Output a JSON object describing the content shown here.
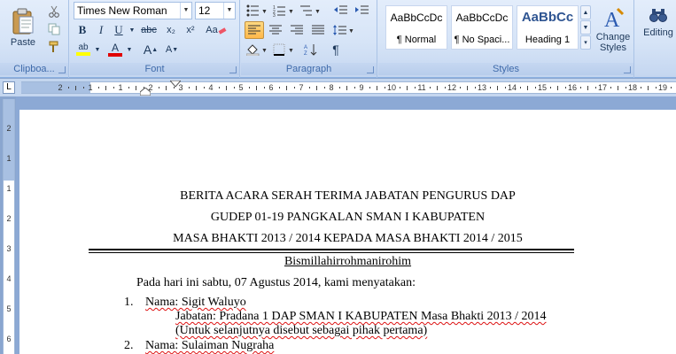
{
  "ribbon": {
    "clipboard": {
      "paste_label": "Paste",
      "group_label": "Clipboa..."
    },
    "font": {
      "font_name": "Times New Roman",
      "font_size": "12",
      "bold": "B",
      "italic": "I",
      "underline": "U",
      "strikethrough": "abc",
      "subscript": "x₂",
      "superscript": "x²",
      "clear_format": "Aa",
      "highlight_label": "ab",
      "font_color_label": "A",
      "grow_font": "A",
      "shrink_font": "A",
      "group_label": "Font"
    },
    "paragraph": {
      "show_marks": "¶",
      "group_label": "Paragraph"
    },
    "styles": {
      "tiles": [
        {
          "sample": "AaBbCcDc",
          "name": "¶ Normal"
        },
        {
          "sample": "AaBbCcDc",
          "name": "¶ No Spaci..."
        },
        {
          "sample": "AaBbCc",
          "name": "Heading 1"
        }
      ],
      "change_styles_line1": "Change",
      "change_styles_line2": "Styles",
      "group_label": "Styles"
    },
    "editing": {
      "label": "Editing"
    }
  },
  "ruler": {
    "tab_selector": "L",
    "h_numbers": [
      "2",
      "1",
      "1",
      "2",
      "3",
      "4",
      "5",
      "6",
      "7",
      "8",
      "9",
      "10",
      "11",
      "12",
      "13",
      "14",
      "15",
      "16",
      "17",
      "18",
      "19"
    ],
    "v_numbers": [
      "2",
      "1",
      "1",
      "2",
      "3",
      "4",
      "5",
      "6",
      "7"
    ]
  },
  "document": {
    "title_line1": "BERITA ACARA SERAH TERIMA JABATAN PENGURUS DAP",
    "title_line2": "GUDEP 01-19 PANGKALAN SMAN I KABUPATEN",
    "title_line3": "MASA BHAKTI 2013 / 2014 KEPADA MASA BHAKTI 2014 / 2015",
    "bismillah": "Bismillahirrohmanirohim",
    "intro": "Pada hari ini sabtu, 07 Agustus 2014, kami menyatakan:",
    "items": [
      {
        "num": "1.",
        "name": "Nama: Sigit Waluyo",
        "jabatan": "Jabatan: Pradana 1 DAP SMAN I KABUPATEN Masa Bhakti 2013 / 2014",
        "note": "(Untuk selanjutnya disebut sebagai pihak pertama)"
      },
      {
        "num": "2.",
        "name": "Nama: Sulaiman Nugraha"
      }
    ]
  }
}
